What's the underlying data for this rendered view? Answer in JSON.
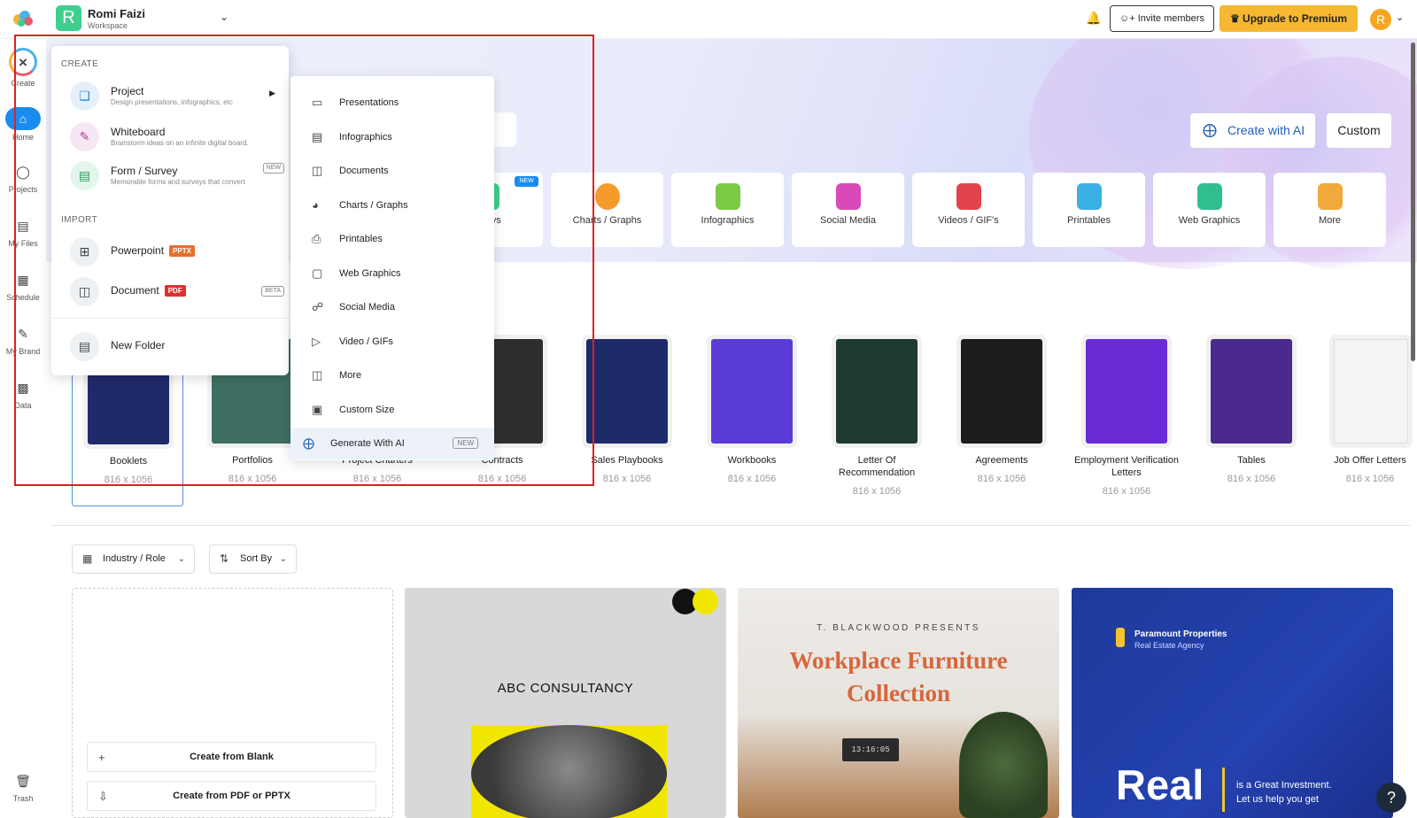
{
  "topbar": {
    "workspace_initial": "R",
    "workspace_name": "Romi Faizi",
    "workspace_sub": "Workspace",
    "invite_label": "Invite members",
    "upgrade_label": "Upgrade to Premium",
    "user_initial": "R"
  },
  "sidenav": [
    {
      "label": "Create"
    },
    {
      "label": "Home"
    },
    {
      "label": "Projects"
    },
    {
      "label": "My Files"
    },
    {
      "label": "Schedule"
    },
    {
      "label": "My Brand"
    },
    {
      "label": "Data"
    }
  ],
  "trash_label": "Trash",
  "hero": {
    "create_ai_label": "Create with AI",
    "custom_label": "Custom",
    "new_badge": "NEW",
    "categories": [
      {
        "label": "urveys",
        "color": "#3ecf8e"
      },
      {
        "label": "Charts / Graphs",
        "color": "#f59a2b"
      },
      {
        "label": "Infographics",
        "color": "#7ccb46"
      },
      {
        "label": "Social Media",
        "color": "#d94ab8"
      },
      {
        "label": "Videos / GIF's",
        "color": "#e2444d"
      },
      {
        "label": "Printables",
        "color": "#3ab0e6"
      },
      {
        "label": "Web Graphics",
        "color": "#2fbf8f"
      },
      {
        "label": "More",
        "color": "#f2a93b"
      }
    ]
  },
  "templates": [
    {
      "name": "Booklets",
      "size": "816 x 1056",
      "color": "#1f2a6b"
    },
    {
      "name": "Portfolios",
      "size": "816 x 1056",
      "color": "#3f6f62"
    },
    {
      "name": "Project Charters",
      "size": "816 x 1056",
      "color": "#e8e8e8"
    },
    {
      "name": "Contracts",
      "size": "816 x 1056",
      "color": "#2e2e2e"
    },
    {
      "name": "Sales Playbooks",
      "size": "816 x 1056",
      "color": "#1f2a6b"
    },
    {
      "name": "Workbooks",
      "size": "816 x 1056",
      "color": "#5a3bd6"
    },
    {
      "name": "Letter Of Recommendation",
      "size": "816 x 1056",
      "color": "#1e3a33"
    },
    {
      "name": "Agreements",
      "size": "816 x 1056",
      "color": "#1c1c1c"
    },
    {
      "name": "Employment Verification Letters",
      "size": "816 x 1056",
      "color": "#6a2bd6"
    },
    {
      "name": "Tables",
      "size": "816 x 1056",
      "color": "#4a2a8c"
    },
    {
      "name": "Job Offer Letters",
      "size": "816 x 1056",
      "color": "#f4f4f4"
    }
  ],
  "filters": {
    "industry_label": "Industry / Role",
    "sort_label": "Sort By"
  },
  "blank": {
    "create_blank": "Create from Blank",
    "create_pdf": "Create from PDF or PPTX"
  },
  "big_templates": [
    {
      "title": "ABC CONSULTANCY"
    },
    {
      "kicker": "T. BLACKWOOD PRESENTS",
      "title": "Workplace Furniture Collection",
      "clock": "13:16:05"
    },
    {
      "brand": "Paramount Properties",
      "sub": "Real Estate Agency",
      "big": "Real",
      "tag": "is a Great Investment.",
      "tag2": "Let us help you get"
    }
  ],
  "create_menu": {
    "create_heading": "CREATE",
    "import_heading": "IMPORT",
    "items": [
      {
        "title": "Project",
        "sub": "Design presentations, infographics, etc"
      },
      {
        "title": "Whiteboard",
        "sub": "Brainstorm ideas on an infinite digital board."
      },
      {
        "title": "Form / Survey",
        "sub": "Memorable forms and surveys that convert",
        "badge": "NEW"
      }
    ],
    "imports": [
      {
        "title": "Powerpoint",
        "tag": "PPTX",
        "tag_color": "#e8702a"
      },
      {
        "title": "Document",
        "tag": "PDF",
        "tag_color": "#e02f2f",
        "badge": "BETA"
      }
    ],
    "folder": "New Folder"
  },
  "submenu": [
    {
      "label": "Presentations"
    },
    {
      "label": "Infographics"
    },
    {
      "label": "Documents"
    },
    {
      "label": "Charts / Graphs"
    },
    {
      "label": "Printables"
    },
    {
      "label": "Web Graphics"
    },
    {
      "label": "Social Media"
    },
    {
      "label": "Video / GIFs"
    },
    {
      "label": "More"
    },
    {
      "label": "Custom Size"
    },
    {
      "label": "Generate With AI",
      "badge": "NEW"
    }
  ]
}
